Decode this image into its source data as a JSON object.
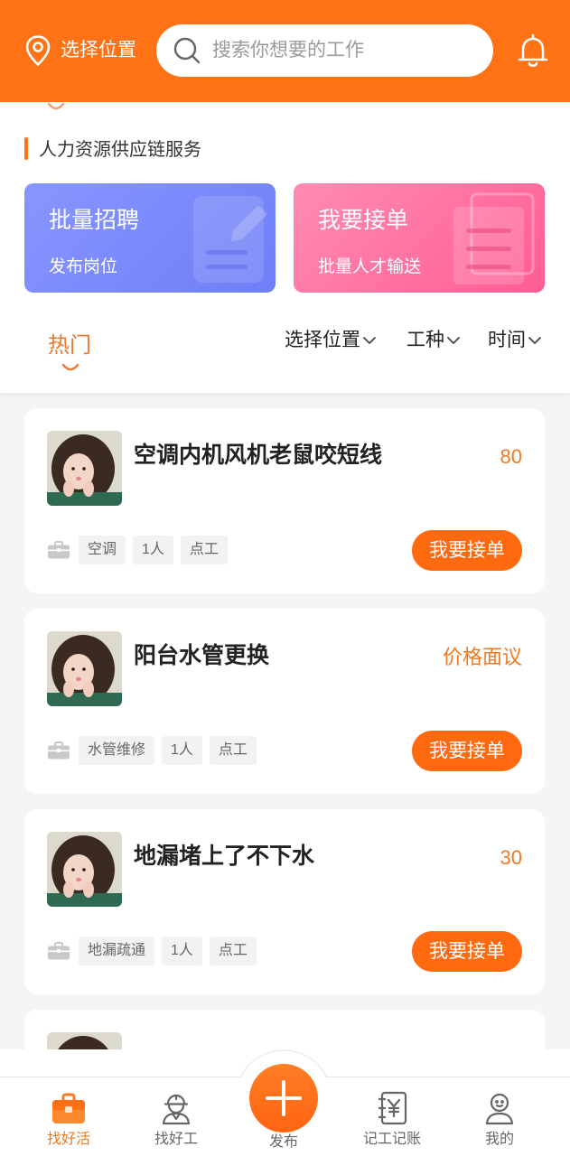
{
  "header": {
    "location_label": "选择位置",
    "location_icon": "location-pin-icon",
    "search_icon": "search-icon",
    "search_placeholder": "搜索你想要的工作",
    "notification_icon": "bell-icon"
  },
  "service_section": {
    "title": "人力资源供应链服务"
  },
  "promo_cards": [
    {
      "title": "批量招聘",
      "subtitle": "发布岗位",
      "icon": "edit-document-icon",
      "color": "#7A89FB"
    },
    {
      "title": "我要接单",
      "subtitle": "批量人才输送",
      "icon": "document-stack-icon",
      "color": "#FF6E9F"
    }
  ],
  "filter_bar": {
    "active_tab": "热门",
    "dropdowns": [
      {
        "label": "选择位置",
        "icon": "chevron-down-icon"
      },
      {
        "label": "工种",
        "icon": "chevron-down-icon"
      },
      {
        "label": "时间",
        "icon": "chevron-down-icon"
      }
    ]
  },
  "jobs": [
    {
      "title": "空调内机风机老鼠咬短线",
      "price": "80",
      "tag_icon": "briefcase-icon",
      "tags": [
        "空调",
        "1人",
        "点工"
      ],
      "action_label": "我要接单"
    },
    {
      "title": "阳台水管更换",
      "price": "价格面议",
      "tag_icon": "briefcase-icon",
      "tags": [
        "水管维修",
        "1人",
        "点工"
      ],
      "action_label": "我要接单"
    },
    {
      "title": "地漏堵上了不下水",
      "price": "30",
      "tag_icon": "briefcase-icon",
      "tags": [
        "地漏疏通",
        "1人",
        "点工"
      ],
      "action_label": "我要接单"
    }
  ],
  "bottom_nav": {
    "items": [
      {
        "label": "找好活",
        "icon": "briefcase-icon",
        "active": true
      },
      {
        "label": "找好工",
        "icon": "worker-icon",
        "active": false
      },
      {
        "label": "发布",
        "icon": "plus-icon",
        "active": false
      },
      {
        "label": "记工记账",
        "icon": "ledger-icon",
        "active": false
      },
      {
        "label": "我的",
        "icon": "profile-icon",
        "active": false
      }
    ]
  },
  "colors": {
    "primary": "#FF7216",
    "accent_text": "#F07A22",
    "action_button": "#FF6A10",
    "page_background": "#F5F5F5",
    "tag_background": "#F2F2F2"
  }
}
